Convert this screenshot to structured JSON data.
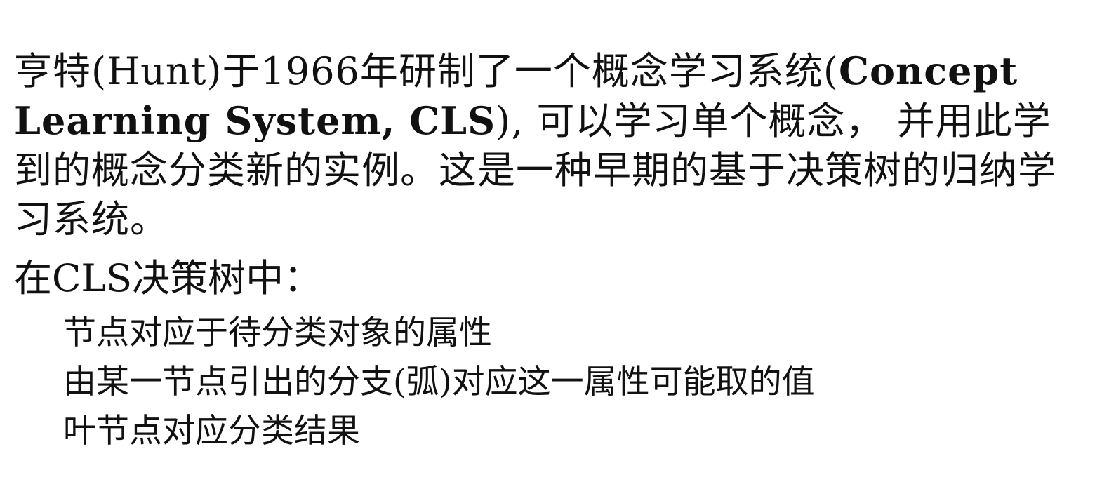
{
  "intro": {
    "part1": "亨特(Hunt)于1966年研制了一个概念学习系统(",
    "bold_term": "Concept Learning System, CLS",
    "part2": "), 可以学习单个概念， 并用此学到的概念分类新的实例。这是一种早期的基于决策树的归纳学习系统。"
  },
  "cls_section": {
    "title": "在CLS决策树中：",
    "points": [
      "节点对应于待分类对象的属性",
      "由某一节点引出的分支(弧)对应这一属性可能取的值",
      "叶节点对应分类结果"
    ]
  }
}
